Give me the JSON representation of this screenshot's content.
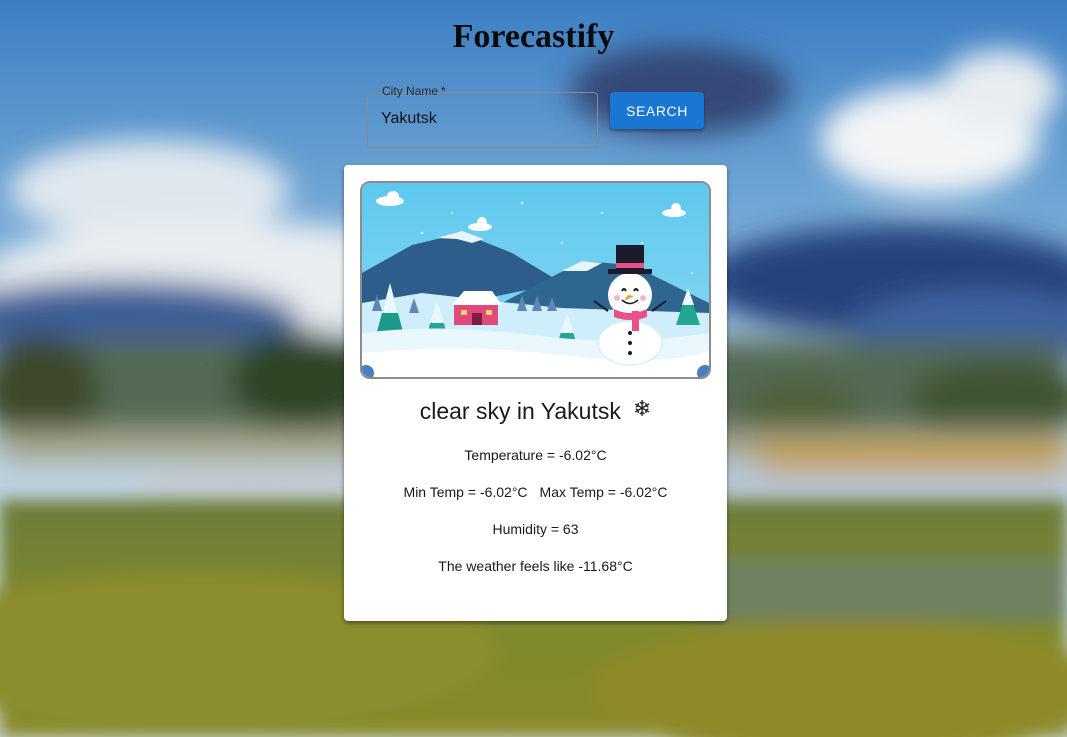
{
  "app": {
    "title": "Forecastify"
  },
  "search": {
    "label": "City Name",
    "required_mark": "*",
    "value": "Yakutsk",
    "button_label": "SEARCH"
  },
  "weather": {
    "heading": "clear sky in Yakutsk",
    "condition_icon": "snowflake-icon",
    "temperature": "Temperature = -6.02°C",
    "min_temp": "Min Temp = -6.02°C",
    "max_temp": "Max Temp = -6.02°C",
    "humidity": "Humidity = 63",
    "feels_like": "The weather feels like -11.68°C",
    "illustration": "snowman-winter-scene"
  },
  "colors": {
    "accent": "#1976d2",
    "card": "#ffffff",
    "title": "#0a0a0a"
  }
}
